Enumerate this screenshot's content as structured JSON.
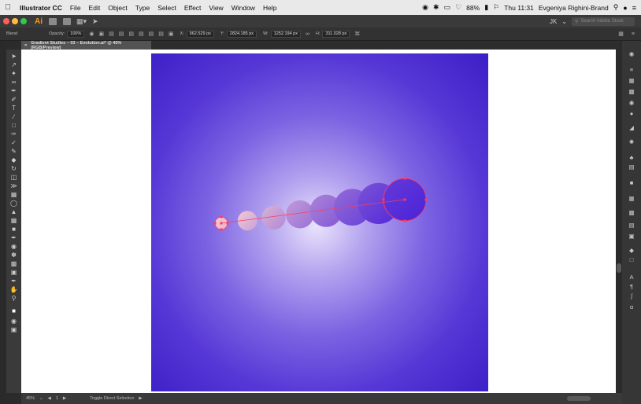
{
  "menubar": {
    "apple": "",
    "app_name": "Illustrator CC",
    "items": [
      "File",
      "Edit",
      "Object",
      "Type",
      "Select",
      "Effect",
      "View",
      "Window",
      "Help"
    ],
    "battery": "88%",
    "clock": "Thu 11:31",
    "user": "Evgeniya Righini-Brand"
  },
  "appbar": {
    "logo": "Ai",
    "workspace_user": "JK",
    "search_placeholder": "Search Adobe Stock"
  },
  "controlbar": {
    "selection_label": "Blend",
    "opacity_label": "Opacity:",
    "opacity_value": "100%",
    "x_label": "X:",
    "x_value": "962.529 px",
    "y_label": "Y:",
    "y_value": "2824.185 px",
    "w_label": "W:",
    "w_value": "1252.194 px",
    "h_label": "H:",
    "h_value": "311.028 px"
  },
  "document": {
    "tab_close": "×",
    "tab_title": "Gradient Studies – 03 – Evolution.ai* @ 45% (RGB/Preview)"
  },
  "artwork": {
    "gradient_center_color": "#e9e3fb",
    "gradient_edge_color": "#3b1fc6",
    "blend_path_color": "#ff3b5c",
    "start_fill": "#f1c9d6",
    "end_fill": "#4b22d8"
  },
  "statusbar": {
    "zoom": "45%",
    "artboard_number": "1",
    "tool_status": "Toggle Direct Selection"
  },
  "icons": {
    "tools": [
      "selection-icon",
      "direct-selection-icon",
      "magic-wand-icon",
      "lasso-icon",
      "pen-icon",
      "curvature-icon",
      "type-icon",
      "line-icon",
      "rectangle-icon",
      "paintbrush-icon",
      "shaper-icon",
      "pencil-icon",
      "eraser-icon",
      "rotate-icon",
      "scale-icon",
      "width-icon",
      "free-transform-icon",
      "shape-builder-icon",
      "perspective-icon",
      "mesh-icon",
      "gradient-icon",
      "eyedropper-icon",
      "blend-icon",
      "symbol-sprayer-icon",
      "column-graph-icon",
      "artboard-icon",
      "slice-icon",
      "hand-icon",
      "zoom-icon",
      "fill-stroke-icon",
      "draw-mode-icon",
      "screen-mode-icon"
    ],
    "panels": [
      "color-icon",
      "properties-icon",
      "libraries-icon",
      "layers-icon",
      "appearance-icon",
      "graphic-styles-icon",
      "swatches-icon",
      "brushes-icon",
      "symbols-icon",
      "stroke-icon",
      "gradient-panel-icon",
      "transparency-icon",
      "transform-icon",
      "align-icon",
      "pathfinder-icon",
      "artboards-panel-icon",
      "links-icon",
      "character-icon",
      "paragraph-icon",
      "opentype-icon",
      "glyphs-icon"
    ]
  }
}
